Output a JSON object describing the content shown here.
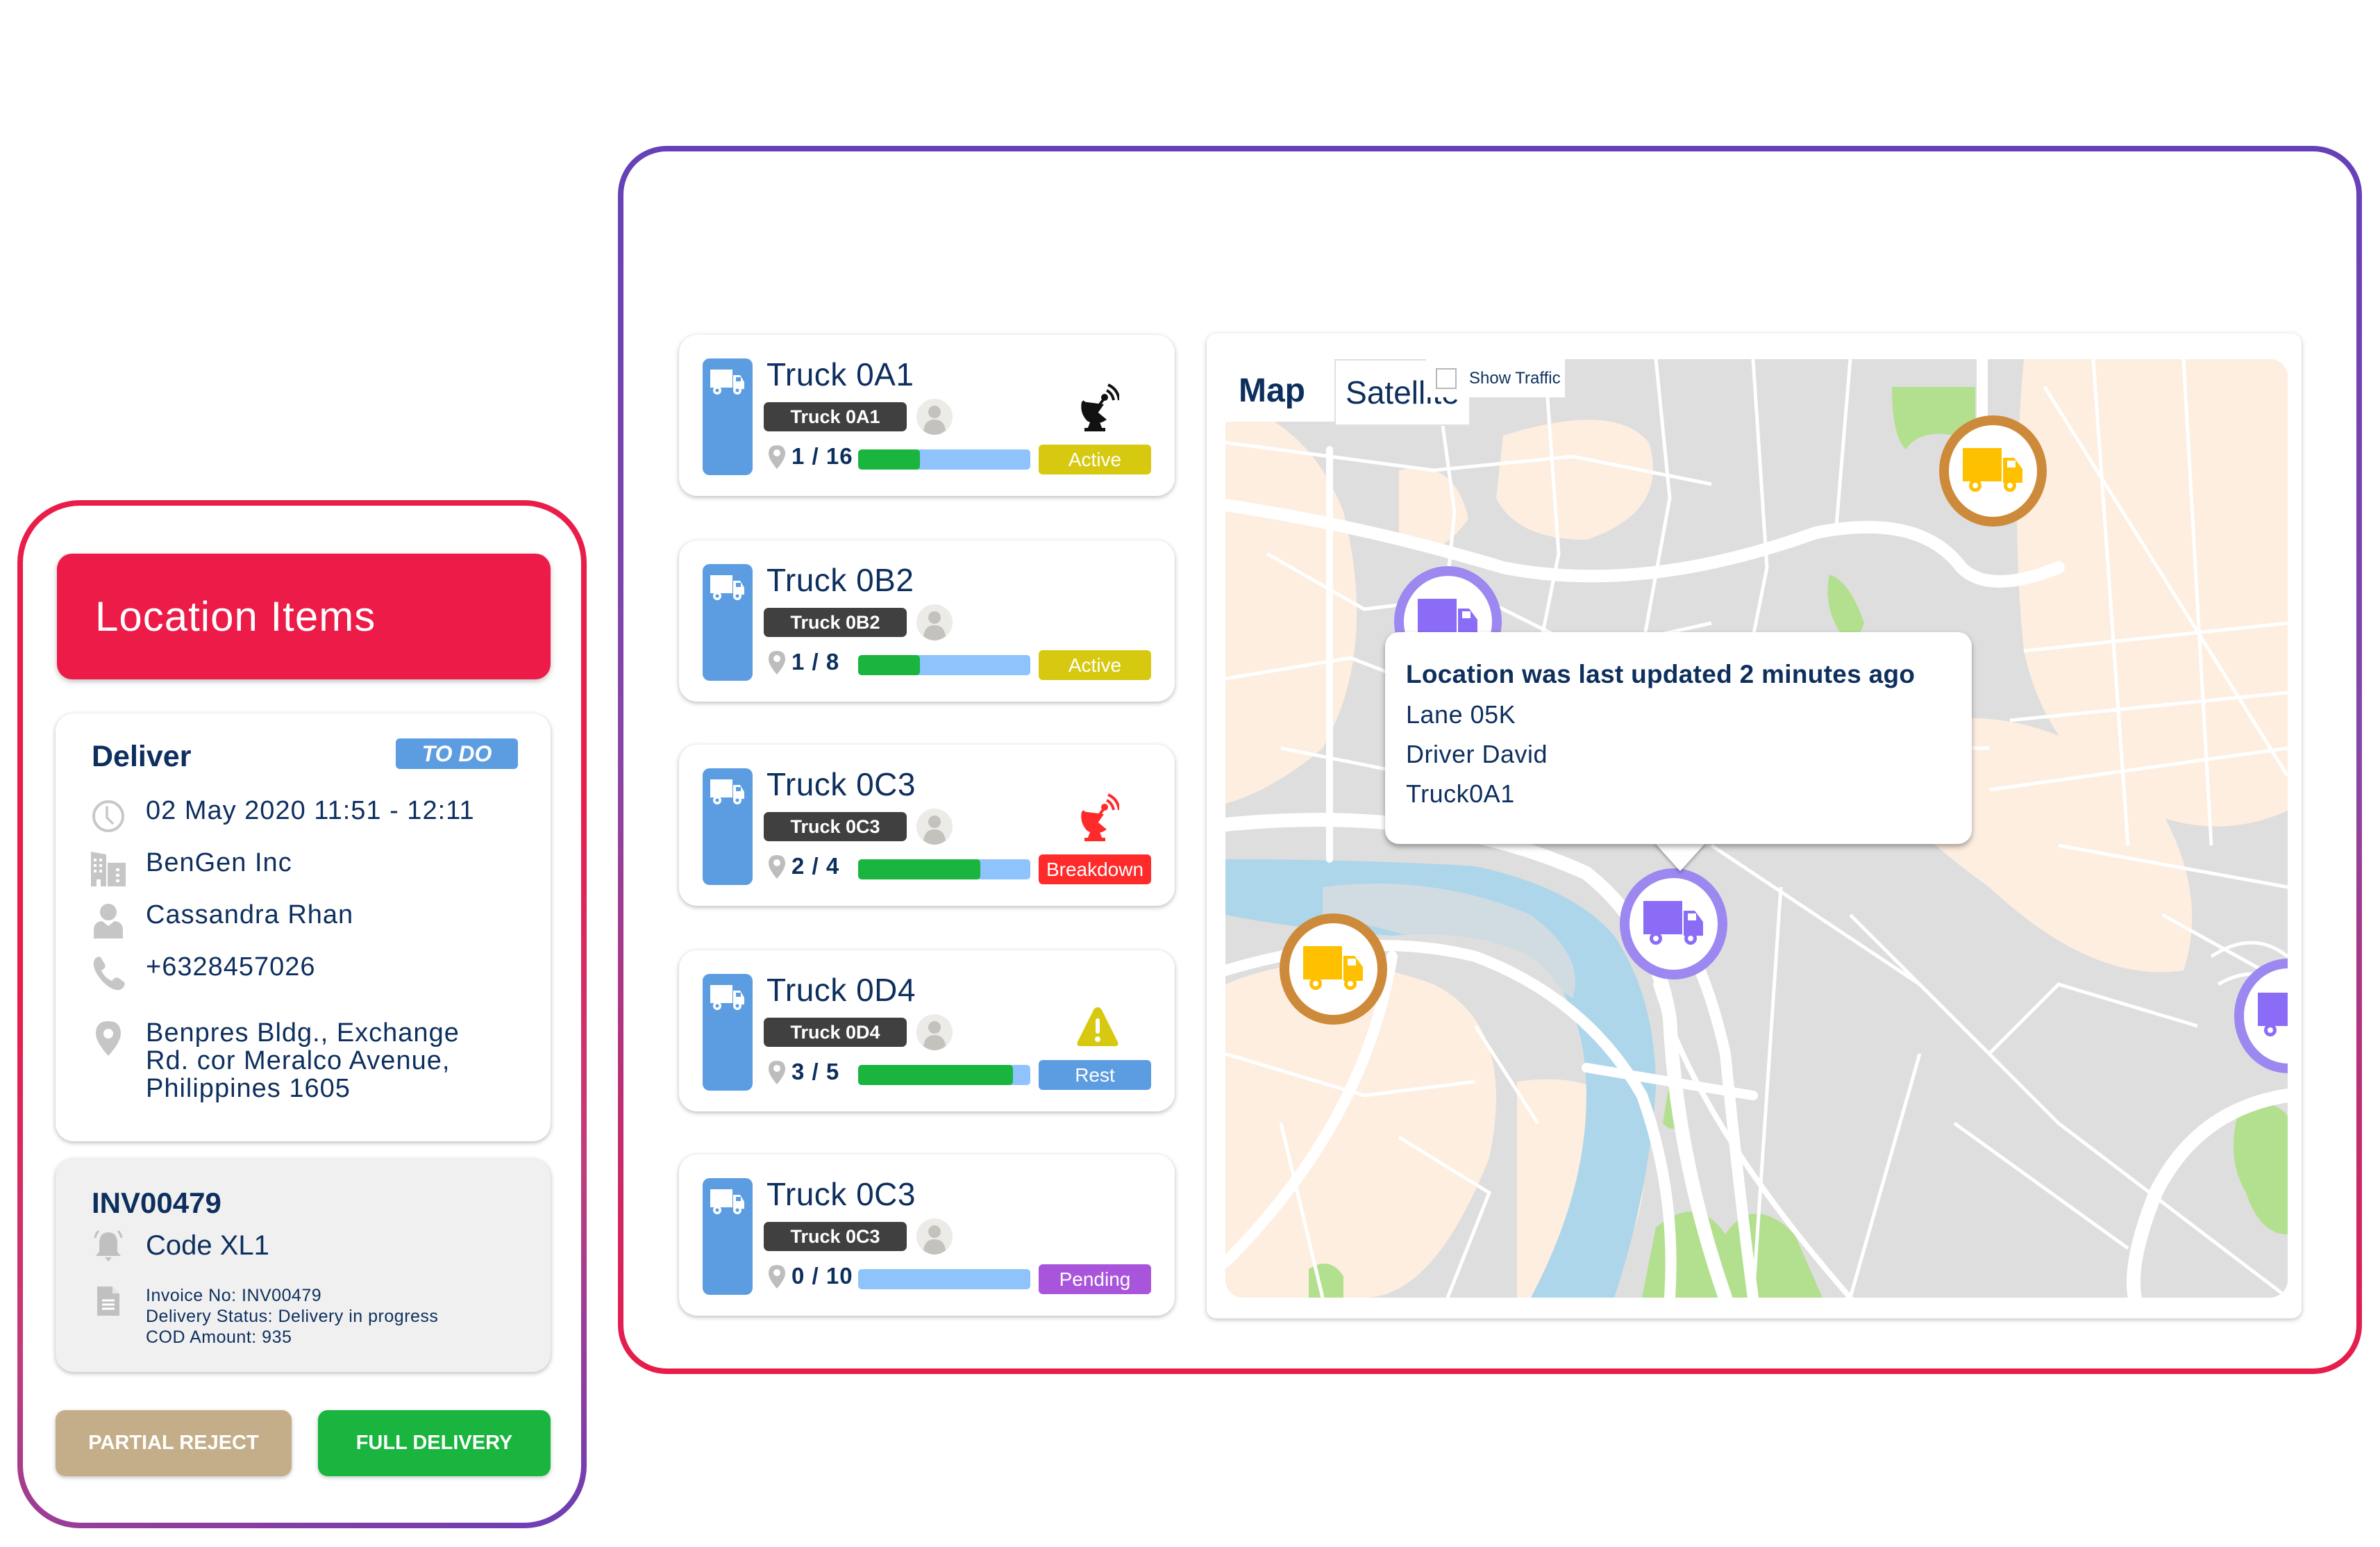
{
  "location_panel": {
    "header_title": "Location Items",
    "deliver_card": {
      "title": "Deliver",
      "badge": "TO DO",
      "datetime": "02 May 2020 11:51 - 12:11",
      "company": "BenGen Inc",
      "contact_name": "Cassandra Rhan",
      "phone": "+6328457026",
      "address_lines": [
        "Benpres Bldg., Exchange",
        "Rd. cor Meralco Avenue,",
        "Philippines 1605"
      ]
    },
    "invoice_card": {
      "title": "INV00479",
      "code": "Code XL1",
      "details": [
        "Invoice No: INV00479",
        "Delivery Status: Delivery in progress",
        "COD Amount: 935"
      ]
    },
    "buttons": {
      "partial_reject": "PARTIAL REJECT",
      "full_delivery": "FULL DELIVERY"
    }
  },
  "trucks": [
    {
      "name": "Truck 0A1",
      "tag": "Truck 0A1",
      "count": "1 / 16",
      "progress": 0.36,
      "status": "Active",
      "status_color": "#d6c910",
      "alert_icon": "satellite-dish-icon",
      "alert_color": "#111111"
    },
    {
      "name": "Truck 0B2",
      "tag": "Truck 0B2",
      "count": "1 / 8",
      "progress": 0.36,
      "status": "Active",
      "status_color": "#d6c910",
      "alert_icon": "",
      "alert_color": ""
    },
    {
      "name": "Truck 0C3",
      "tag": "Truck 0C3",
      "count": "2 / 4",
      "progress": 0.71,
      "status": "Breakdown",
      "status_color": "#ff2a2a",
      "alert_icon": "satellite-dish-icon",
      "alert_color": "#ff2a2a"
    },
    {
      "name": "Truck 0D4",
      "tag": "Truck 0D4",
      "count": "3 / 5",
      "progress": 0.9,
      "status": "Rest",
      "status_color": "#5c9ce1",
      "alert_icon": "warning-icon",
      "alert_color": "#d6c910"
    },
    {
      "name": "Truck 0C3",
      "tag": "Truck 0C3",
      "count": "0 / 10",
      "progress": 0.0,
      "status": "Pending",
      "status_color": "#a855db",
      "alert_icon": "",
      "alert_color": ""
    }
  ],
  "map": {
    "tab_map": "Map",
    "tab_satellite": "Satellite",
    "show_traffic_label": "Show Traffic",
    "show_traffic_checked": false,
    "tooltip": {
      "title": "Location was last updated 2 minutes ago",
      "lane": "Lane 05K",
      "driver": "Driver David",
      "truck": "Truck0A1"
    },
    "markers": [
      {
        "color": "orange"
      },
      {
        "color": "purple"
      },
      {
        "color": "purple"
      },
      {
        "color": "orange"
      },
      {
        "color": "purple"
      }
    ]
  },
  "colors": {
    "primary_text": "#0d2f5e",
    "header_red": "#ec1b48",
    "badge_blue": "#5c9ce1",
    "progress_green": "#19b53e",
    "progress_track": "#8ec3fb",
    "marker_orange": "#cd8a3a",
    "marker_purple": "#9d87f0",
    "truck_yellow": "#ffc000",
    "truck_purple": "#8b6cf7"
  }
}
